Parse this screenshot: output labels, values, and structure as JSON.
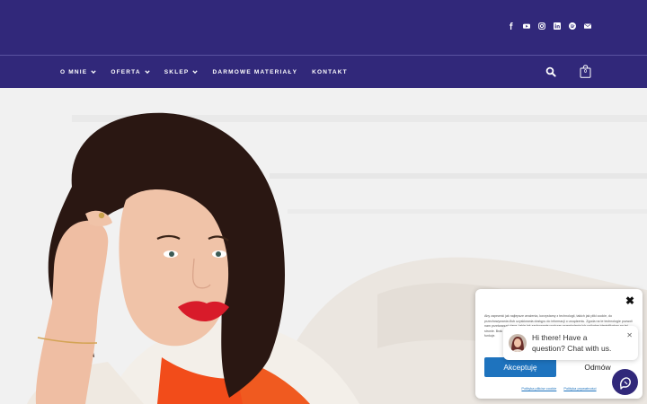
{
  "colors": {
    "brand": "#31287a",
    "accent": "#1e73be",
    "lipstick": "#d81b2a",
    "top": "#ff5a1f"
  },
  "social": [
    "facebook-icon",
    "youtube-icon",
    "instagram-icon",
    "linkedin-icon",
    "spotify-icon",
    "email-icon"
  ],
  "nav": {
    "items": [
      {
        "label": "O MNIE",
        "dropdown": true
      },
      {
        "label": "OFERTA",
        "dropdown": true
      },
      {
        "label": "SKLEP",
        "dropdown": true
      },
      {
        "label": "DARMOWE MATERIAŁY",
        "dropdown": false
      },
      {
        "label": "KONTAKT",
        "dropdown": false
      }
    ],
    "cart_count": "0"
  },
  "cookie": {
    "close": "✖",
    "text": "Aby zapewnić jak najlepsze wrażenia, korzystamy z technologii, takich jak pliki cookie, do przechowywania i/lub uzyskiwania dostępu do informacji o urządzeniu. Zgoda na te technologie pozwoli nam przetwarzać dane, takie jak zachowanie podczas przeglądania lub unikalne identyfikatory na tej stronie. Brak wyrażenia zgody lub wycofanie zgody może niekorzystnie wpłynąć na niektóre cechy i funkcje.",
    "accept": "Akceptuję",
    "deny": "Odmów",
    "links": [
      "Polityka plików cookie",
      "Polityka prywatności"
    ]
  },
  "chat": {
    "message": "Hi there! Have a question? Chat with us.",
    "close": "✕"
  }
}
